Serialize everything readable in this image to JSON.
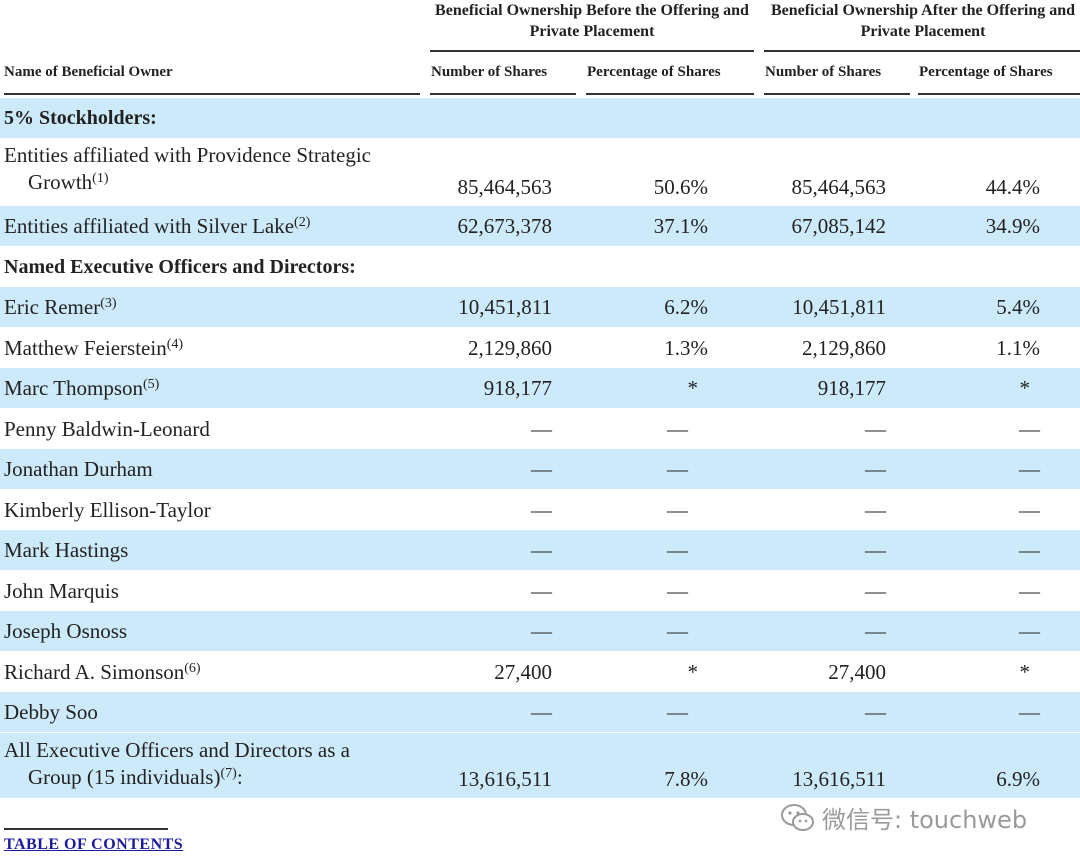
{
  "header": {
    "group_before": "Beneficial Ownership Before the Offering and Private Placement",
    "group_after": "Beneficial Ownership After the Offering and Private Placement",
    "name_col": "Name of Beneficial Owner",
    "shares_before": "Number of Shares",
    "pct_before": "Percentage of Shares",
    "shares_after": "Number of Shares",
    "pct_after": "Percentage of Shares"
  },
  "rows": [
    {
      "type": "section",
      "label": "5% Stockholders:"
    },
    {
      "type": "data",
      "name_l1": "Entities affiliated with Providence Strategic",
      "name_l2": "Growth",
      "note": "(1)",
      "shares_before": "85,464,563",
      "pct_before": "50.6%",
      "shares_after": "85,464,563",
      "pct_after": "44.4%"
    },
    {
      "type": "data",
      "name": "Entities affiliated with Silver Lake",
      "note": "(2)",
      "shares_before": "62,673,378",
      "pct_before": "37.1%",
      "shares_after": "67,085,142",
      "pct_after": "34.9%"
    },
    {
      "type": "section",
      "label": "Named Executive Officers and Directors:"
    },
    {
      "type": "data",
      "name": "Eric Remer",
      "note": "(3)",
      "shares_before": "10,451,811",
      "pct_before": "6.2%",
      "shares_after": "10,451,811",
      "pct_after": "5.4%"
    },
    {
      "type": "data",
      "name": "Matthew Feierstein",
      "note": "(4)",
      "shares_before": "2,129,860",
      "pct_before": "1.3%",
      "shares_after": "2,129,860",
      "pct_after": "1.1%"
    },
    {
      "type": "data",
      "name": "Marc Thompson",
      "note": "(5)",
      "shares_before": "918,177",
      "pct_before": "*",
      "shares_after": "918,177",
      "pct_after": "*"
    },
    {
      "type": "data",
      "name": "Penny Baldwin-Leonard",
      "note": "",
      "shares_before": "—",
      "pct_before": "—",
      "shares_after": "—",
      "pct_after": "—"
    },
    {
      "type": "data",
      "name": "Jonathan Durham",
      "note": "",
      "shares_before": "—",
      "pct_before": "—",
      "shares_after": "—",
      "pct_after": "—"
    },
    {
      "type": "data",
      "name": "Kimberly Ellison-Taylor",
      "note": "",
      "shares_before": "—",
      "pct_before": "—",
      "shares_after": "—",
      "pct_after": "—"
    },
    {
      "type": "data",
      "name": "Mark Hastings",
      "note": "",
      "shares_before": "—",
      "pct_before": "—",
      "shares_after": "—",
      "pct_after": "—"
    },
    {
      "type": "data",
      "name": "John Marquis",
      "note": "",
      "shares_before": "—",
      "pct_before": "—",
      "shares_after": "—",
      "pct_after": "—"
    },
    {
      "type": "data",
      "name": "Joseph Osnoss",
      "note": "",
      "shares_before": "—",
      "pct_before": "—",
      "shares_after": "—",
      "pct_after": "—"
    },
    {
      "type": "data",
      "name": "Richard A. Simonson",
      "note": "(6)",
      "shares_before": "27,400",
      "pct_before": "*",
      "shares_after": "27,400",
      "pct_after": "*"
    },
    {
      "type": "data",
      "name": "Debby Soo",
      "note": "",
      "shares_before": "—",
      "pct_before": "—",
      "shares_after": "—",
      "pct_after": "—"
    },
    {
      "type": "data",
      "name_l1": "All Executive Officers and Directors as a",
      "name_l2": "Group (15 individuals)",
      "note": "(7)",
      "suffix": ":",
      "shares_before": "13,616,511",
      "pct_before": "7.8%",
      "shares_after": "13,616,511",
      "pct_after": "6.9%"
    }
  ],
  "footer": {
    "toc_link": "TABLE OF CONTENTS"
  },
  "watermark": {
    "text": "微信号: touchweb",
    "icon": "wechat-icon"
  }
}
